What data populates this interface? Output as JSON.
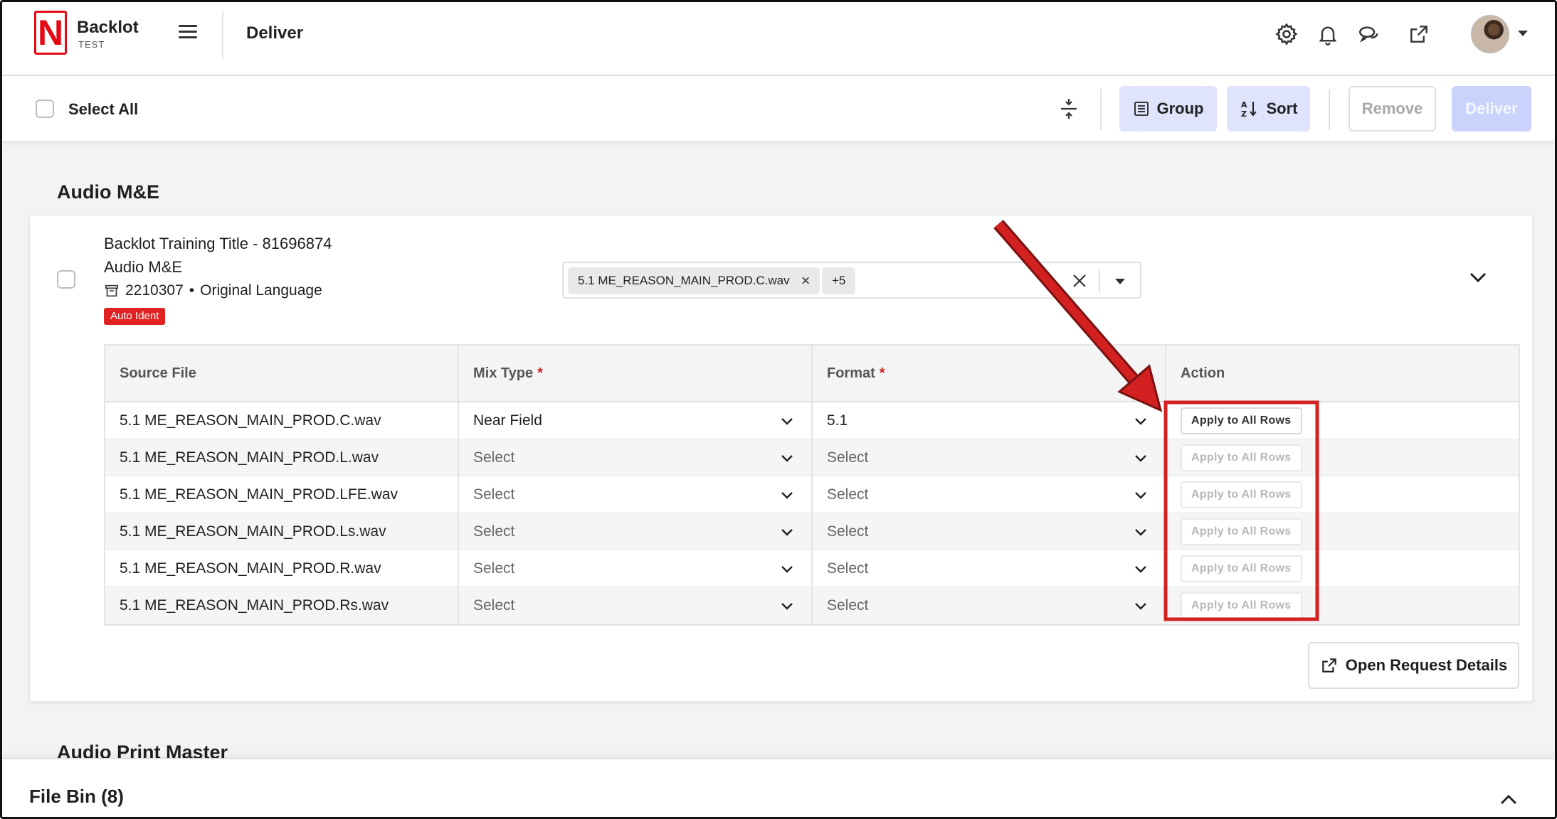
{
  "app": {
    "logo_letter": "N",
    "name": "Backlot",
    "environment": "TEST",
    "page_title": "Deliver"
  },
  "nav_icons": [
    "gear-icon",
    "bell-icon",
    "chat-icon",
    "external-link-icon",
    "avatar",
    "chevron-down-icon"
  ],
  "toolbar": {
    "select_all_label": "Select All",
    "group_label": "Group",
    "sort_label": "Sort",
    "remove_label": "Remove",
    "deliver_label": "Deliver"
  },
  "section": {
    "title": "Audio M&E",
    "next_section_title": "Audio Print Master"
  },
  "request": {
    "title": "Backlot Training Title - 81696874",
    "type": "Audio M&E",
    "id": "2210307",
    "separator": "•",
    "language": "Original Language",
    "badge": "Auto Ident",
    "selected_file_chip": "5.1 ME_REASON_MAIN_PROD.C.wav",
    "more_chip": "+5"
  },
  "table": {
    "headers": {
      "source_file": "Source File",
      "mix_type": "Mix Type",
      "format": "Format",
      "action": "Action",
      "required_marker": "*"
    },
    "rows": [
      {
        "source_file": "5.1 ME_REASON_MAIN_PROD.C.wav",
        "mix_type": "Near Field",
        "format": "5.1",
        "action": "Apply to All Rows",
        "enabled": true
      },
      {
        "source_file": "5.1 ME_REASON_MAIN_PROD.L.wav",
        "mix_type": "Select",
        "format": "Select",
        "action": "Apply to All Rows",
        "enabled": false
      },
      {
        "source_file": "5.1 ME_REASON_MAIN_PROD.LFE.wav",
        "mix_type": "Select",
        "format": "Select",
        "action": "Apply to All Rows",
        "enabled": false
      },
      {
        "source_file": "5.1 ME_REASON_MAIN_PROD.Ls.wav",
        "mix_type": "Select",
        "format": "Select",
        "action": "Apply to All Rows",
        "enabled": false
      },
      {
        "source_file": "5.1 ME_REASON_MAIN_PROD.R.wav",
        "mix_type": "Select",
        "format": "Select",
        "action": "Apply to All Rows",
        "enabled": false
      },
      {
        "source_file": "5.1 ME_REASON_MAIN_PROD.Rs.wav",
        "mix_type": "Select",
        "format": "Select",
        "action": "Apply to All Rows",
        "enabled": false
      }
    ]
  },
  "open_request_details_label": "Open Request Details",
  "file_bin": {
    "label": "File Bin (8)"
  },
  "colors": {
    "brand_red": "#e50914",
    "primary_light": "#dfe3fb",
    "deliver_disabled": "#c9d3fb",
    "annotation_red": "#d32020",
    "badge_red": "#e02222"
  }
}
